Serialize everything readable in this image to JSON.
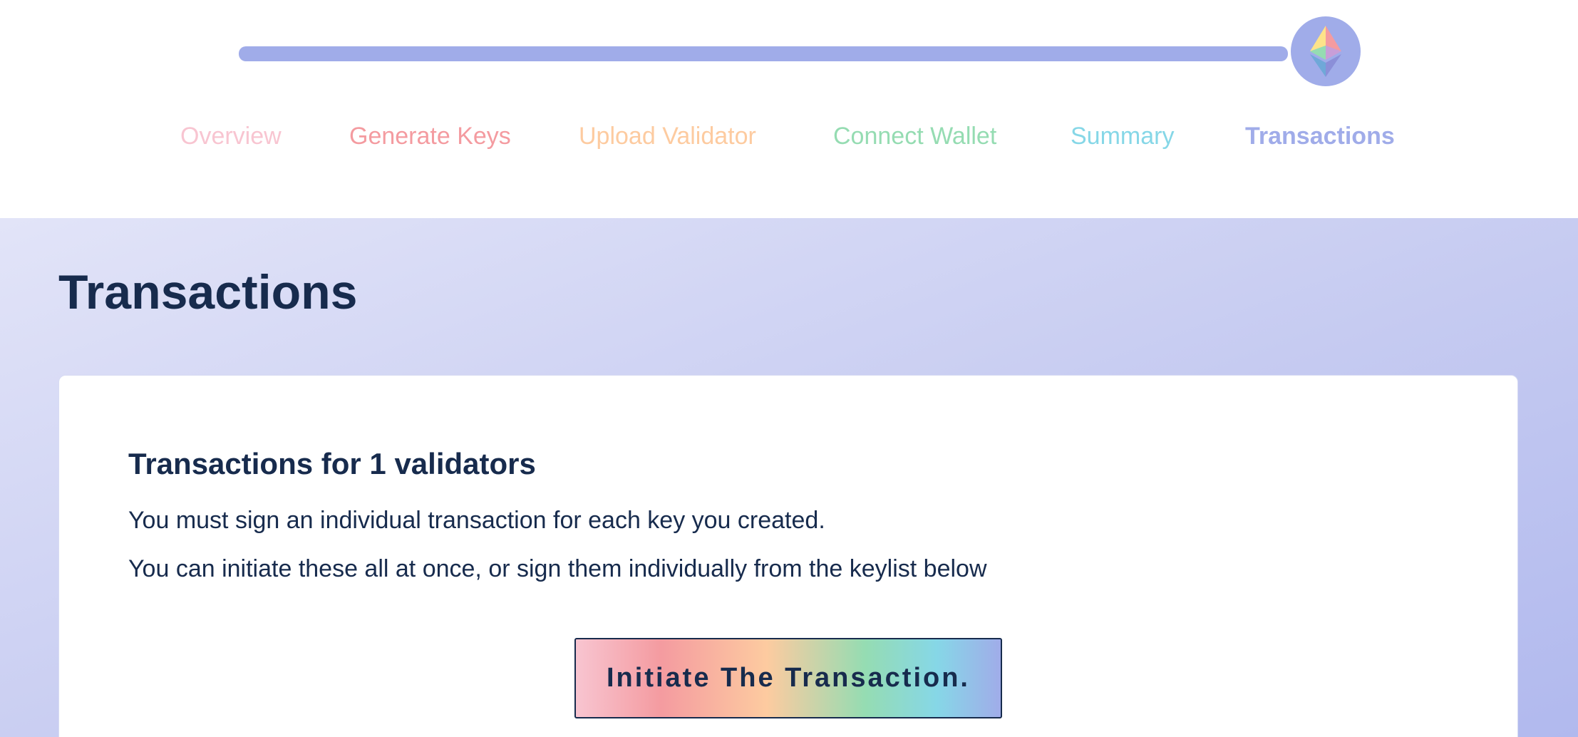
{
  "header": {
    "progress_percent": 100,
    "badge_icon": "ethereum-icon",
    "steps": [
      {
        "label": "Overview",
        "color": "#F8C5D1"
      },
      {
        "label": "Generate Keys",
        "color": "#F49BA0"
      },
      {
        "label": "Upload Validator",
        "color": "#FDCBA0"
      },
      {
        "label": "Connect Wallet",
        "color": "#95DCB2"
      },
      {
        "label": "Summary",
        "color": "#86D7E7"
      },
      {
        "label": "Transactions",
        "color": "#A0ACE9",
        "active": true
      }
    ]
  },
  "main": {
    "title": "Transactions",
    "card": {
      "heading": "Transactions for 1 validators",
      "paragraph_1": "You must sign an individual transaction for each key you created.",
      "paragraph_2": "You can initiate these all at once, or sign them individually from the keylist below",
      "initiate_button_label": "Initiate The Transaction."
    }
  },
  "colors": {
    "text": "#172B4D",
    "accent": "#A0ACE9",
    "background_gradient": [
      "#E2E4F8",
      "#B1B9EE"
    ]
  }
}
